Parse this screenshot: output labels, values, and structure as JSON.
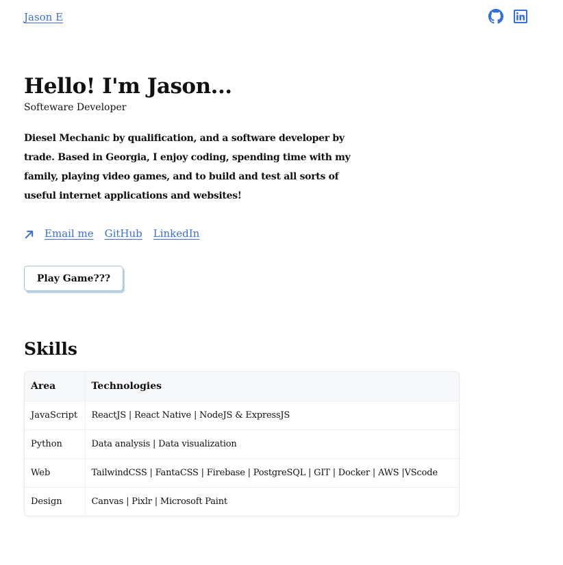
{
  "header": {
    "brand_label": "Jason E",
    "social_icons": [
      "github-icon",
      "linkedin-icon"
    ],
    "icon_color": "#2f6fe0"
  },
  "hero": {
    "title": "Hello! I'm Jason...",
    "subtitle": "Softeware Developer",
    "bio": "Diesel Mechanic by qualification, and a software developer by trade. Based in Georgia, I enjoy coding, spending time with my family, playing video games, and to build and test all sorts of useful internet applications and websites!"
  },
  "contact": {
    "icon": "arrow-up-right-icon",
    "links": [
      "Email me",
      "GitHub",
      "LinkedIn"
    ],
    "link_color": "#3a6fd6"
  },
  "game_button": {
    "label": "Play Game???"
  },
  "skills": {
    "title": "Skills",
    "columns": [
      "Area",
      "Technologies"
    ],
    "rows": [
      [
        "JavaScript",
        "ReactJS | React Native | NodeJS & ExpressJS"
      ],
      [
        "Python",
        "Data analysis | Data visualization"
      ],
      [
        "Web",
        "TailwindCSS | FantaCSS | Firebase | PostgreSQL | GIT | Docker | AWS |VScode"
      ],
      [
        "Design",
        "Canvas | Pixlr | Microsoft Paint"
      ]
    ]
  }
}
